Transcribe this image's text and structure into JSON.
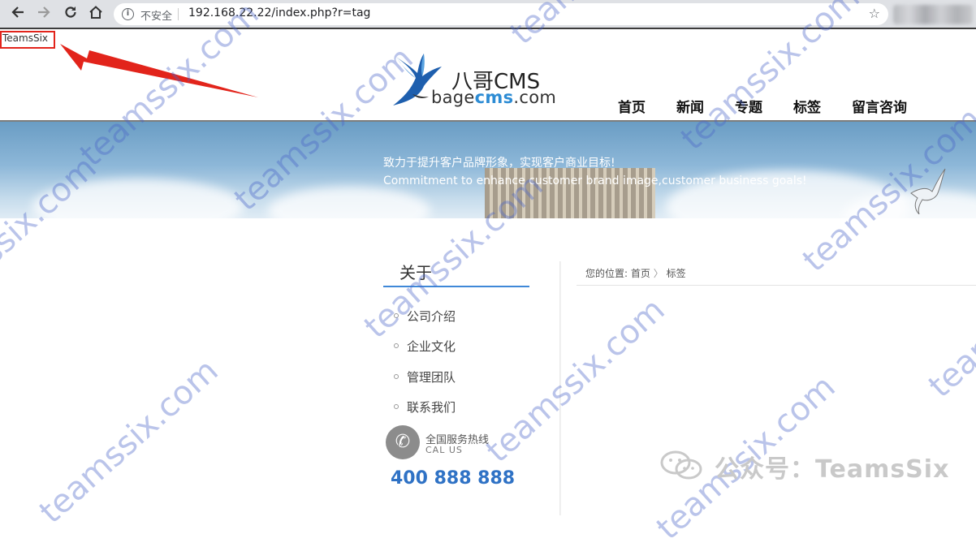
{
  "browser": {
    "back_icon": "arrow-left-icon",
    "forward_icon": "arrow-right-icon",
    "reload_icon": "reload-icon",
    "home_icon": "home-icon",
    "security_label": "不安全",
    "url": "192.168.22.22/index.php?r=tag",
    "bookmark_icon": "star-icon"
  },
  "page": {
    "injected_text": "TeamsSix",
    "annotation_color": "#e2241b"
  },
  "logo": {
    "title": "八哥CMS",
    "sub_prefix": "bage",
    "sub_highlight": "cms",
    "sub_suffix": ".com"
  },
  "nav": {
    "items": [
      {
        "label": "首页"
      },
      {
        "label": "新闻"
      },
      {
        "label": "专题"
      },
      {
        "label": "标签"
      },
      {
        "label": "留言咨询"
      }
    ]
  },
  "banner": {
    "slogan_cn": "致力于提升客户品牌形象，实现客户商业目标!",
    "slogan_en": "Commitment to enhance customer brand image,customer business goals!"
  },
  "sidebar": {
    "title": "关于",
    "items": [
      {
        "label": "公司介绍"
      },
      {
        "label": "企业文化"
      },
      {
        "label": "管理团队"
      },
      {
        "label": "联系我们"
      }
    ],
    "hotline": {
      "label_cn": "全国服务热线",
      "label_en": "CAL US",
      "number": "400 888 888",
      "icon": "phone-icon"
    }
  },
  "breadcrumb": {
    "prefix": "您的位置:",
    "home": "首页",
    "separator": "〉",
    "current": "标签"
  },
  "watermark": {
    "text": "teamssix.com",
    "wechat_label": "公众号：TeamsSix",
    "color": "#4a64c8"
  }
}
